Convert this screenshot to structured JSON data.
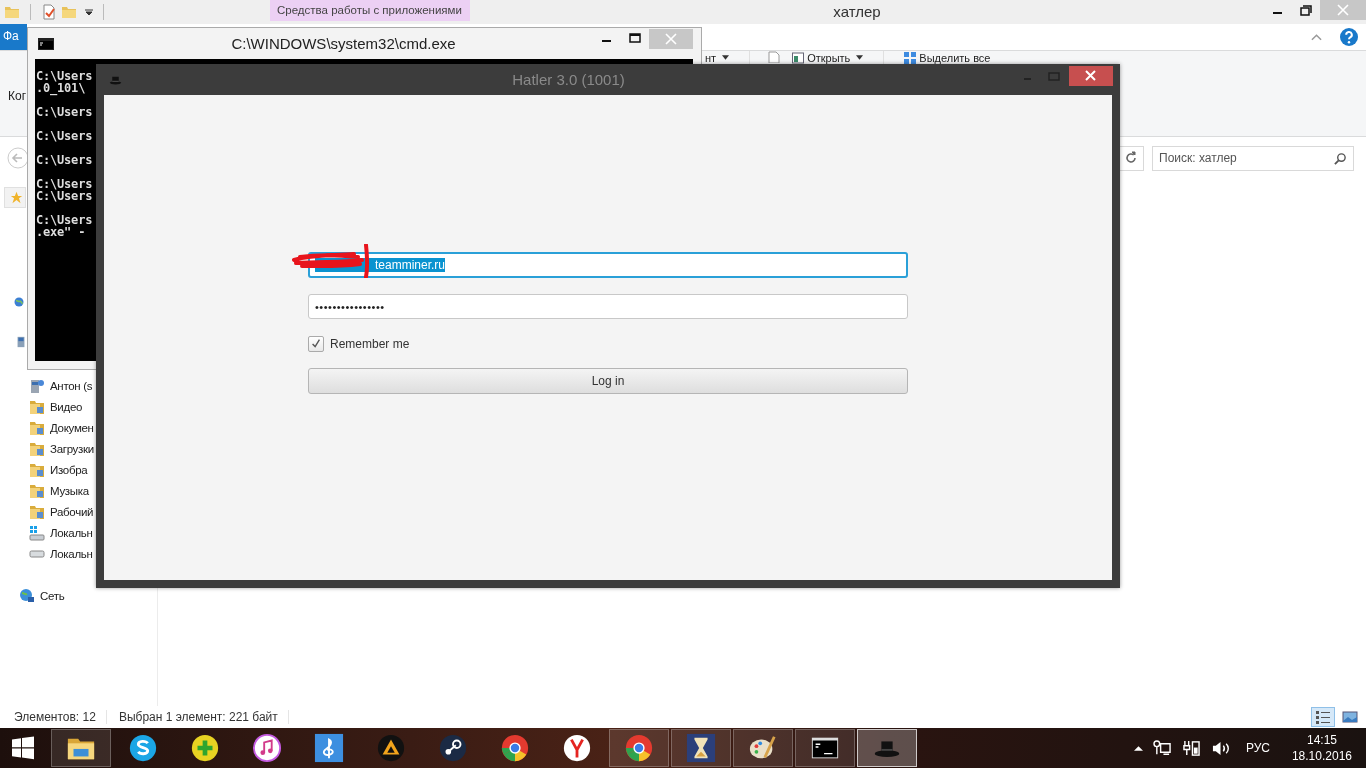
{
  "explorer": {
    "title": "хатлер",
    "contextual_tab": "Средства работы с приложениями",
    "file_tab": "Фа",
    "ribbon_group_label": "Ког",
    "ribbon_items": [
      {
        "label": "нт",
        "kind": "dropdown"
      },
      {
        "label": "Открыть",
        "kind": "open"
      },
      {
        "label": "Выделить все",
        "kind": "select-all"
      }
    ],
    "search": {
      "placeholder": "Поиск: хатлер"
    },
    "nav_items": [
      {
        "label": "Антон (s",
        "kind": "user"
      },
      {
        "label": "Видео",
        "kind": "folder"
      },
      {
        "label": "Докумен",
        "kind": "folder"
      },
      {
        "label": "Загрузки",
        "kind": "folder"
      },
      {
        "label": "Изобра",
        "kind": "folder"
      },
      {
        "label": "Музыка",
        "kind": "folder"
      },
      {
        "label": "Рабочий",
        "kind": "folder"
      },
      {
        "label": "Локальн",
        "kind": "system-drive"
      },
      {
        "label": "Локальн",
        "kind": "drive"
      }
    ],
    "network": "Сеть",
    "status": {
      "count": "Элементов: 12",
      "selection": "Выбран 1 элемент: 221 байт"
    },
    "view_buttons": [
      {
        "kind": "details",
        "selected": true
      },
      {
        "kind": "thumbnails",
        "selected": false
      }
    ]
  },
  "cmd": {
    "title": "C:\\WINDOWS\\system32\\cmd.exe",
    "lines": [
      {
        "kind": "text",
        "text": "C:\\Users"
      },
      {
        "kind": "text",
        "text": ".0_101\\"
      },
      {
        "kind": "blank"
      },
      {
        "kind": "text",
        "text": "C:\\Users"
      },
      {
        "kind": "blank"
      },
      {
        "kind": "text",
        "text": "C:\\Users"
      },
      {
        "kind": "blank"
      },
      {
        "kind": "text",
        "text": "C:\\Users"
      },
      {
        "kind": "blank"
      },
      {
        "kind": "text",
        "text": "C:\\Users"
      },
      {
        "kind": "text",
        "text": "C:\\Users"
      },
      {
        "kind": "blank"
      },
      {
        "kind": "text",
        "text": "C:\\Users"
      },
      {
        "kind": "text",
        "text": ".exe\" -"
      }
    ]
  },
  "hatler": {
    "title": "Hatler 3.0 (1001)",
    "login": {
      "value": "teamminer.ru",
      "focused": true,
      "text_selected": true
    },
    "password": {
      "value": "••••••••••••••••",
      "focused": false,
      "text_selected": false
    },
    "remember": {
      "label": "Remember me",
      "checked": true
    },
    "button": "Log in"
  },
  "taskbar": {
    "apps": [
      {
        "kind": "explorer",
        "running": true,
        "active": false
      },
      {
        "kind": "skype",
        "running": false,
        "active": false
      },
      {
        "kind": "plus",
        "running": false,
        "active": false
      },
      {
        "kind": "note",
        "running": false,
        "active": false
      },
      {
        "kind": "clef",
        "running": false,
        "active": false
      },
      {
        "kind": "triangle",
        "running": false,
        "active": false
      },
      {
        "kind": "steam",
        "running": false,
        "active": false
      },
      {
        "kind": "chrome",
        "running": false,
        "active": false
      },
      {
        "kind": "yandex",
        "running": false,
        "active": false
      },
      {
        "kind": "chrome",
        "running": true,
        "active": false
      },
      {
        "kind": "hourglass",
        "running": true,
        "active": false
      },
      {
        "kind": "paint",
        "running": true,
        "active": false
      },
      {
        "kind": "cmd",
        "running": true,
        "active": false
      },
      {
        "kind": "hat",
        "running": true,
        "active": true
      }
    ],
    "language": "РУС",
    "time": "14:15",
    "date": "18.10.2016"
  }
}
